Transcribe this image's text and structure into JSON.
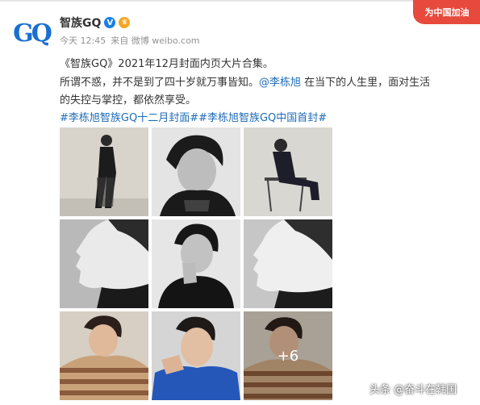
{
  "post": {
    "author": "智族GQ",
    "avatar_text": "GQ",
    "meta_time": "今天 12:45",
    "meta_source": "来自 微博 weibo.com",
    "badge": "为中国加油",
    "line1": "《智族GQ》2021年12月封面内页大片合集。",
    "line2_before": "所谓不惑，并不是到了四十岁就万事皆知。",
    "line2_mention": "@李栋旭",
    "line2_after": " 在当下的人生里，面对生活",
    "line3": "的失控与掌控，都依然享受。",
    "hashtag1": "#李栋旭智族GQ十二月封面#",
    "hashtag2": "#李栋旭智族GQ中国首封#"
  },
  "gallery": {
    "photos": [
      {
        "name": "photo-1",
        "scene": "full-body-standing",
        "tone": "bw"
      },
      {
        "name": "photo-2",
        "scene": "portrait-closeup",
        "tone": "bw"
      },
      {
        "name": "photo-3",
        "scene": "seated-chair",
        "tone": "bw"
      },
      {
        "name": "photo-4",
        "scene": "profile-side",
        "tone": "bw"
      },
      {
        "name": "photo-5",
        "scene": "hand-on-chin",
        "tone": "bw"
      },
      {
        "name": "photo-6",
        "scene": "profile-side",
        "tone": "bw"
      },
      {
        "name": "photo-7",
        "scene": "striped-sweater",
        "tone": "color"
      },
      {
        "name": "photo-8",
        "scene": "blue-sweater",
        "tone": "color"
      },
      {
        "name": "photo-9",
        "scene": "striped-sweater",
        "tone": "color"
      }
    ],
    "more_count": "+6"
  },
  "watermark": "头条 @奋斗在韩国",
  "colors": {
    "link": "#1e6bb8",
    "verified": "#1a7fe6",
    "badge": "#e74a3c",
    "avatar": "#1a6fd0"
  }
}
